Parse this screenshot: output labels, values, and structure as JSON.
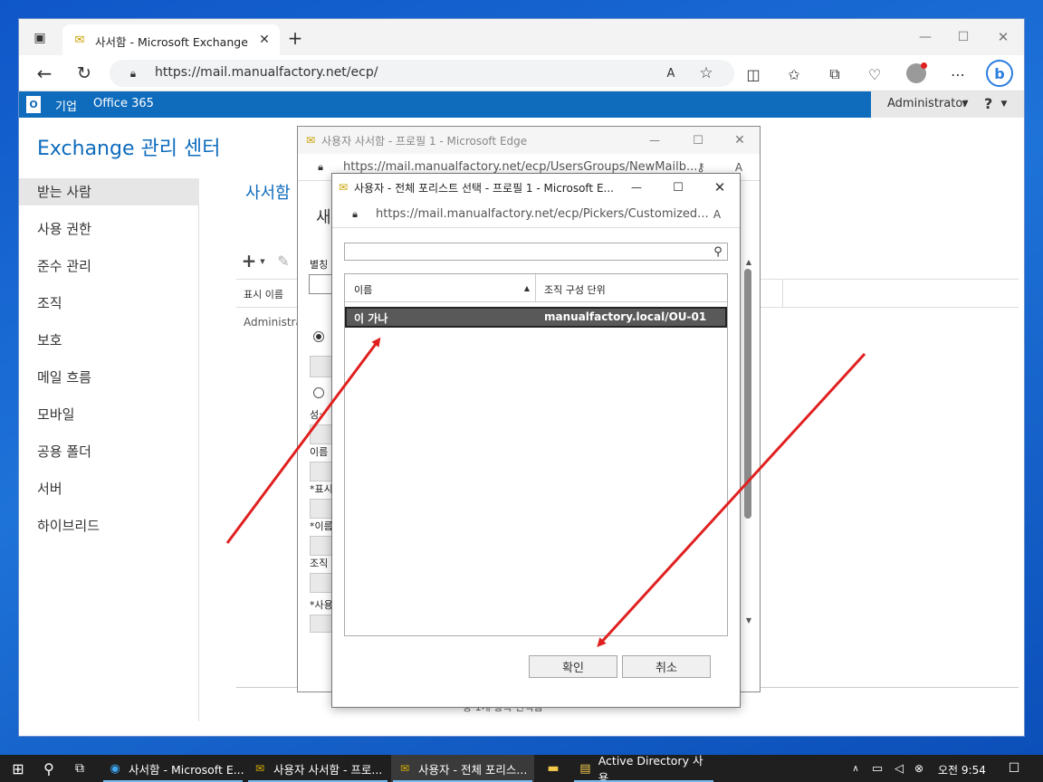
{
  "browser": {
    "tab_title": "사서함 - Microsoft Exchange",
    "url": "https://mail.manualfactory.net/ecp/"
  },
  "topnav": {
    "enterprise": "기업",
    "office365": "Office 365",
    "admin": "Administrator",
    "help": "?"
  },
  "ecp": {
    "title": "Exchange 관리 센터",
    "page_title": "사서함",
    "col_display_name": "표시 이름",
    "row_admin": "Administrat",
    "footer_text": "중 1개 항목 선택됨"
  },
  "sidebar": {
    "items": [
      {
        "label": "받는 사람"
      },
      {
        "label": "사용 권한"
      },
      {
        "label": "준수 관리"
      },
      {
        "label": "조직"
      },
      {
        "label": "보호"
      },
      {
        "label": "메일 흐름"
      },
      {
        "label": "모바일"
      },
      {
        "label": "공용 폴더"
      },
      {
        "label": "서버"
      },
      {
        "label": "하이브리드"
      }
    ]
  },
  "popup1": {
    "title": "사용자 사서함 - 프로필 1 - Microsoft Edge",
    "url": "https://mail.manualfactory.net/ecp/UsersGroups/NewMailb...",
    "heading": "새",
    "alias_label": "별칭",
    "label_first": "성:",
    "label_name": "이름",
    "label_display": "*표시",
    "label_username": "*이름",
    "label_ou": "조직",
    "label_user": "*사용"
  },
  "popup2": {
    "title": "사용자 - 전체 포리스트 선택 - 프로필 1 - Microsoft E...",
    "url": "https://mail.manualfactory.net/ecp/Pickers/Customized...",
    "search_placeholder": "",
    "col_name": "이름",
    "col_ou": "조직 구성 단위",
    "rows": [
      {
        "name": "이 가나",
        "ou": "manualfactory.local/OU-01"
      }
    ],
    "ok_label": "확인",
    "cancel_label": "취소"
  },
  "taskbar": {
    "apps": [
      {
        "label": "사서함 - Microsoft E..."
      },
      {
        "label": "사용자 사서함 - 프로..."
      },
      {
        "label": "사용자 - 전체 포리스..."
      },
      {
        "label": ""
      },
      {
        "label": "Active Directory 사용..."
      }
    ],
    "time": "오전 9:54"
  },
  "colors": {
    "accent": "#0f6cbd",
    "selected_row": "#595959",
    "arrow": "#e02020"
  }
}
